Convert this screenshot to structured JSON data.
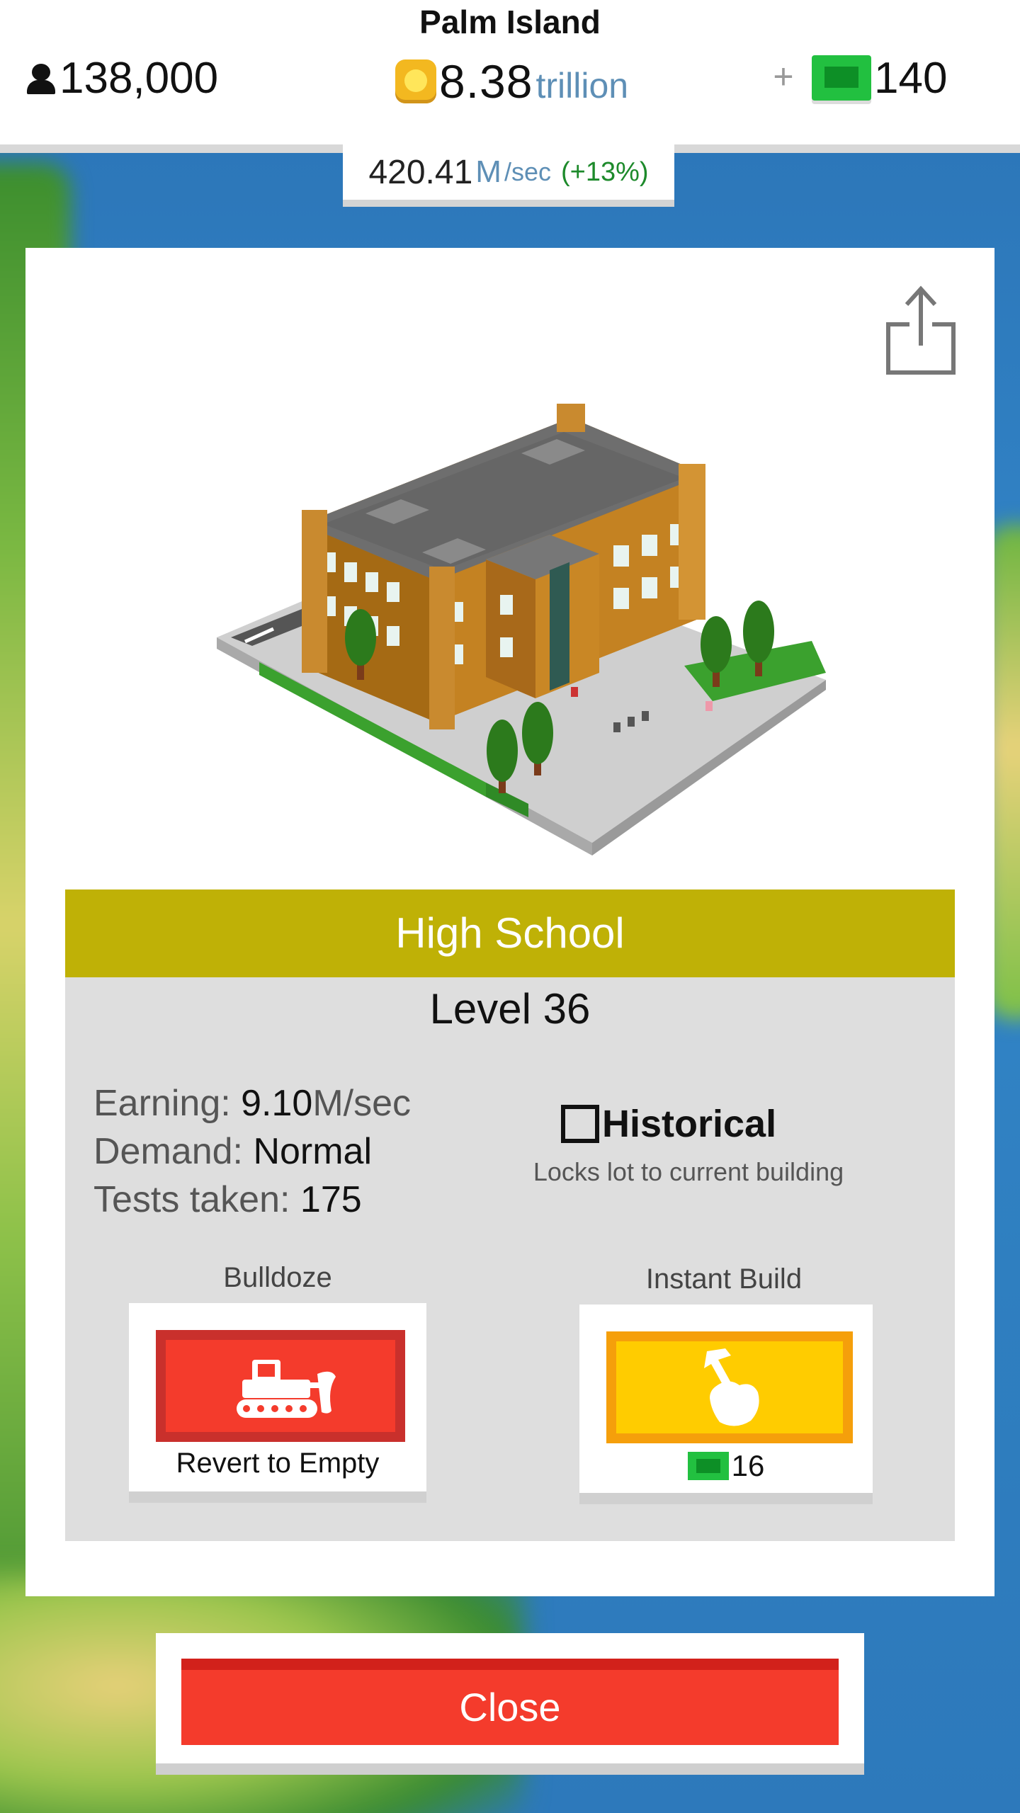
{
  "header": {
    "island_name": "Palm Island",
    "population": "138,000",
    "money_amount": "8.38",
    "money_unit": "trillion",
    "plus_label": "+",
    "premium_cash": "140"
  },
  "income": {
    "rate": "420.41",
    "unit": "M",
    "per": "/sec",
    "change": "(+13%)"
  },
  "building": {
    "name": "High School",
    "level": "Level 36",
    "earning_label": "Earning:",
    "earning_value": "9.10",
    "earning_unit": "M/sec",
    "demand_label": "Demand:",
    "demand_value": "Normal",
    "tests_label": "Tests taken:",
    "tests_value": "175"
  },
  "historical": {
    "checked": false,
    "label": "Historical",
    "description": "Locks lot to current building"
  },
  "actions": {
    "bulldoze_caption": "Bulldoze",
    "bulldoze_label": "Revert to Empty",
    "instant_caption": "Instant Build",
    "instant_cost": "16"
  },
  "close_label": "Close",
  "colors": {
    "title_bar": "#bfb106",
    "bulldoze": "#f43b2c",
    "instant_build": "#ffcc00",
    "premium_cash": "#22c040",
    "income_change": "#1d8a2b"
  },
  "icons": {
    "population": "person-icon",
    "money": "coin-icon",
    "premium": "cash-icon",
    "share": "share-icon",
    "bulldoze": "bulldozer-icon",
    "instant": "hammer-hand-icon"
  }
}
